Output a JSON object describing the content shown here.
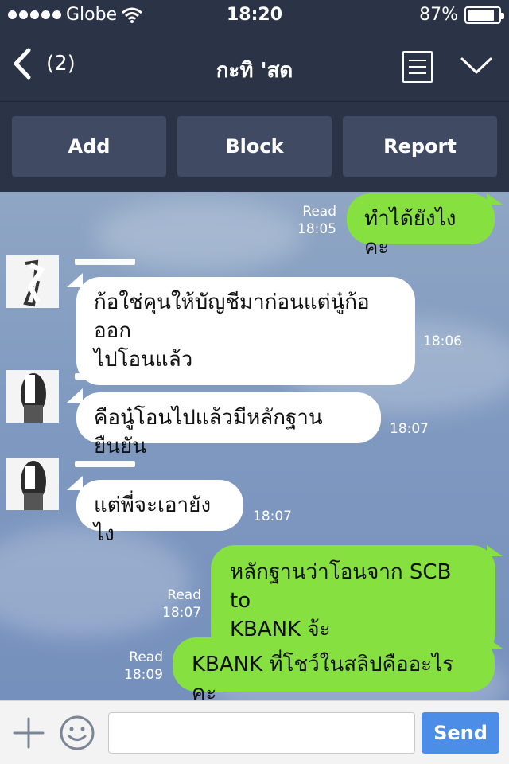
{
  "status_bar": {
    "carrier": "Globe",
    "time": "18:20",
    "battery_percent": "87%",
    "battery_level": 0.87,
    "signal_icon": "signal-dots-icon",
    "wifi_icon": "wifi-icon",
    "battery_icon": "battery-icon"
  },
  "header": {
    "back_count": "(2)",
    "title": "กะทิ 'สด",
    "back_icon": "chevron-left-icon",
    "menu_icon": "menu-icon",
    "expand_icon": "chevron-down-icon"
  },
  "actions": {
    "add_label": "Add",
    "block_label": "Block",
    "report_label": "Report"
  },
  "messages": [
    {
      "direction": "outgoing",
      "text": "ทำได้ยังไงคะ",
      "read_label": "Read",
      "time": "18:05"
    },
    {
      "direction": "incoming",
      "lines": [
        "ก้อใช่คุนให้บัญชีมาก่อนแต่นู๋ก้อออก",
        "ไปโอนแล้ว"
      ],
      "time": "18:06"
    },
    {
      "direction": "incoming",
      "text": "คือนู๋โอนไปแล้วมีหลักฐานยืนยัน",
      "time": "18:07"
    },
    {
      "direction": "incoming",
      "text": "แต่พี่จะเอายังไง",
      "time": "18:07"
    },
    {
      "direction": "outgoing",
      "lines": [
        "หลักฐานว่าโอนจาก SCB to",
        "KBANK จ้ะ"
      ],
      "read_label": "Read",
      "time": "18:07"
    },
    {
      "direction": "outgoing",
      "text": "KBANK ที่โชว์ในสลิปคืออะไรคะ",
      "read_label": "Read",
      "time": "18:09"
    }
  ],
  "composer": {
    "placeholder": "",
    "send_label": "Send",
    "plus_icon": "plus-icon",
    "emoji_icon": "smiley-icon"
  },
  "colors": {
    "header_bg": "#2b3346",
    "button_bg": "#404a63",
    "outgoing_bubble": "#86e040",
    "incoming_bubble": "#ffffff",
    "send_button": "#4c8de8"
  }
}
